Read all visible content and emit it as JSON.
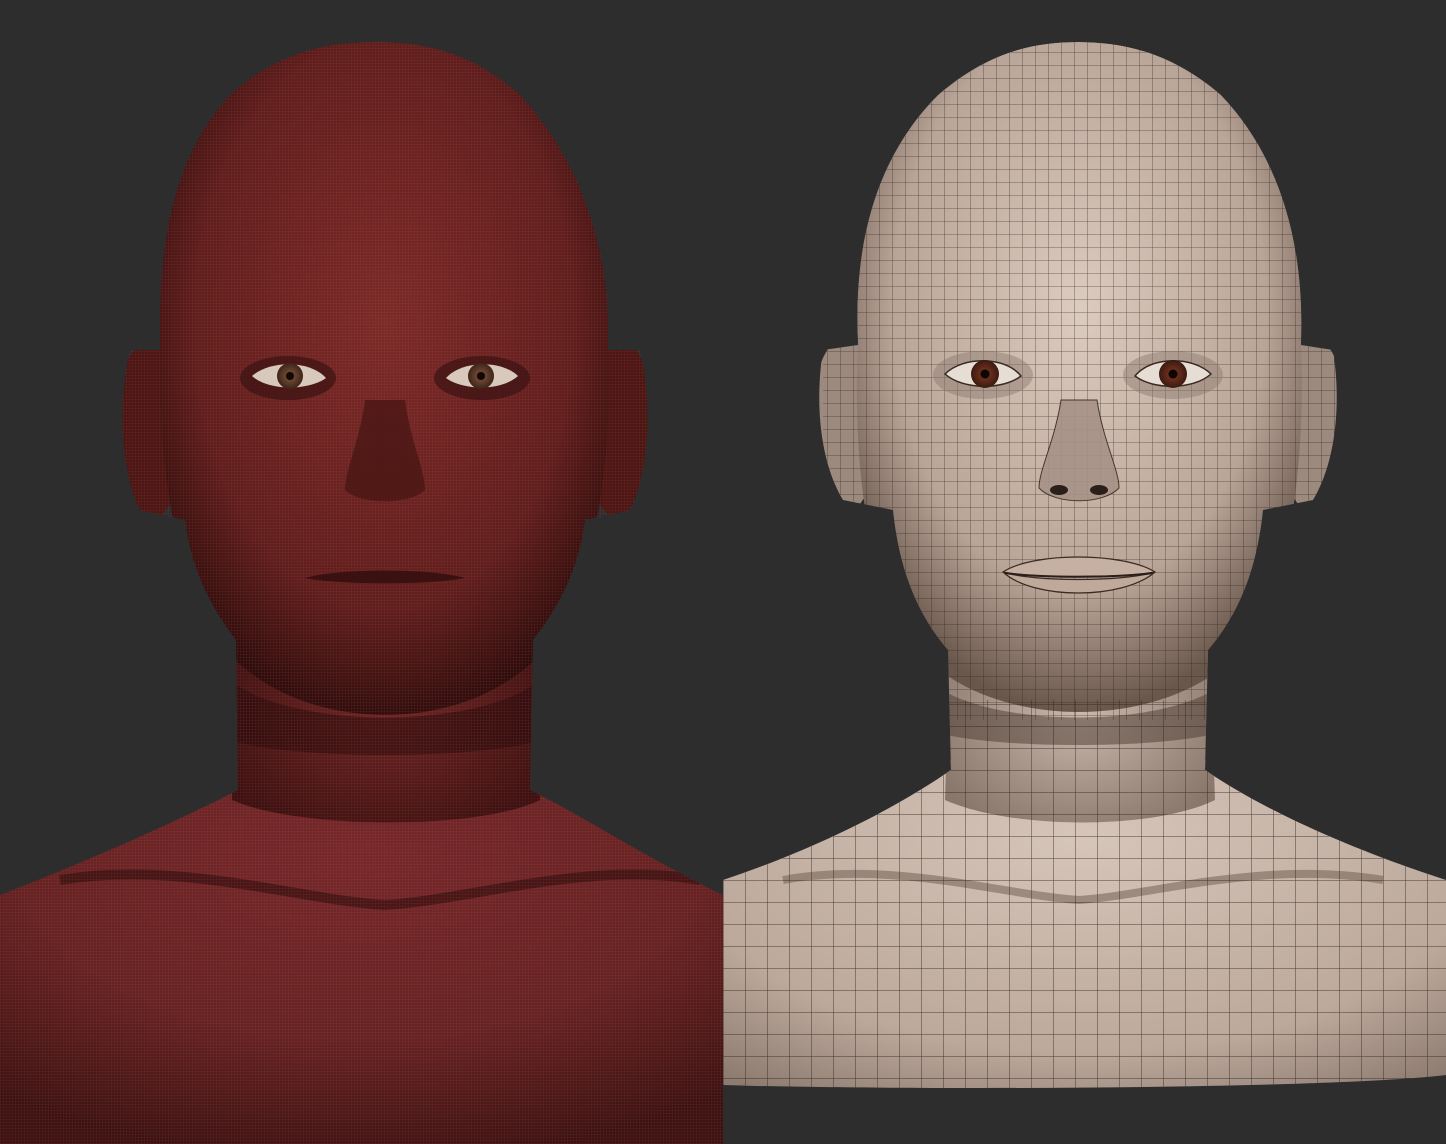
{
  "scene": {
    "background_color": "#2d2d2e",
    "panels": [
      {
        "id": "left",
        "render_style": "dense wireframe, red material",
        "base_color": "#6a2222",
        "shadow_color": "#1e0808",
        "highlight_color": "#8a3a38",
        "wire_color": "#c05050",
        "iris_color": "#6b4632"
      },
      {
        "id": "right",
        "render_style": "quad topology wireframe, skin clay material",
        "base_color": "#b9a598",
        "shadow_color": "#4a3a32",
        "highlight_color": "#dccbbf",
        "wire_color": "#2a1f1a",
        "iris_color": "#6a2e1c"
      }
    ]
  }
}
